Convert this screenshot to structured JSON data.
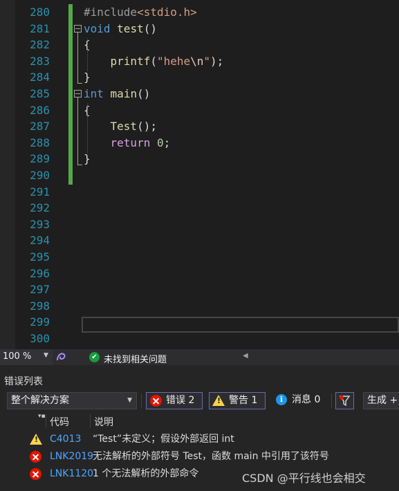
{
  "editor": {
    "lines": [
      {
        "num": "280",
        "tokens": [
          [
            "c-pp",
            "#include"
          ],
          [
            "c-inc",
            "<stdio.h>"
          ]
        ]
      },
      {
        "num": "281",
        "tokens": [
          [
            "c-kw",
            "void"
          ],
          [
            "c-txt",
            " "
          ],
          [
            "c-fn",
            "test"
          ],
          [
            "c-txt",
            "()"
          ]
        ]
      },
      {
        "num": "282",
        "tokens": [
          [
            "c-txt",
            "{"
          ]
        ]
      },
      {
        "num": "283",
        "tokens": [
          [
            "c-txt",
            "    "
          ],
          [
            "c-fn",
            "printf"
          ],
          [
            "c-txt",
            "("
          ],
          [
            "c-str",
            "\"hehe"
          ],
          [
            "c-esc",
            "\\n"
          ],
          [
            "c-str",
            "\""
          ],
          [
            "c-txt",
            ");"
          ]
        ]
      },
      {
        "num": "284",
        "tokens": [
          [
            "c-txt",
            "}"
          ]
        ]
      },
      {
        "num": "285",
        "tokens": [
          [
            "c-kw",
            "int"
          ],
          [
            "c-txt",
            " "
          ],
          [
            "c-fn",
            "main"
          ],
          [
            "c-txt",
            "()"
          ]
        ]
      },
      {
        "num": "286",
        "tokens": [
          [
            "c-txt",
            "{"
          ]
        ]
      },
      {
        "num": "287",
        "tokens": [
          [
            "c-txt",
            "    "
          ],
          [
            "c-fn",
            "Test"
          ],
          [
            "c-txt",
            "();"
          ]
        ]
      },
      {
        "num": "288",
        "tokens": [
          [
            "c-txt",
            "    "
          ],
          [
            "c-ctl",
            "return"
          ],
          [
            "c-txt",
            " "
          ],
          [
            "c-num",
            "0"
          ],
          [
            "c-txt",
            ";"
          ]
        ]
      },
      {
        "num": "289",
        "tokens": [
          [
            "c-txt",
            "}"
          ]
        ]
      },
      {
        "num": "290",
        "tokens": []
      },
      {
        "num": "291",
        "tokens": []
      },
      {
        "num": "292",
        "tokens": []
      },
      {
        "num": "293",
        "tokens": []
      },
      {
        "num": "294",
        "tokens": []
      },
      {
        "num": "295",
        "tokens": []
      },
      {
        "num": "296",
        "tokens": []
      },
      {
        "num": "297",
        "tokens": []
      },
      {
        "num": "298",
        "tokens": []
      },
      {
        "num": "299",
        "tokens": []
      },
      {
        "num": "300",
        "tokens": []
      }
    ]
  },
  "status": {
    "zoom": "100 %",
    "health_text": "未找到相关问题"
  },
  "error_list": {
    "title": "错误列表",
    "scope": "整个解决方案",
    "errors_label": "错误 2",
    "warnings_label": "警告 1",
    "messages_label": "消息 0",
    "build_label": "生成 +",
    "columns": {
      "code": "代码",
      "description": "说明"
    },
    "rows": [
      {
        "severity": "warning",
        "code": "C4013",
        "description": "“Test”未定义；假设外部返回 int"
      },
      {
        "severity": "error",
        "code": "LNK2019",
        "description": "无法解析的外部符号 Test，函数 main 中引用了该符号"
      },
      {
        "severity": "error",
        "code": "LNK1120",
        "description": "1 个无法解析的外部命令"
      }
    ]
  },
  "watermark": "CSDN @平行线也会相交",
  "colors": {
    "error": "#e51400",
    "warning": "#f8d34b",
    "info": "#1c97ea",
    "ok": "#1a9b3b",
    "change_bar": "#57a64a"
  }
}
